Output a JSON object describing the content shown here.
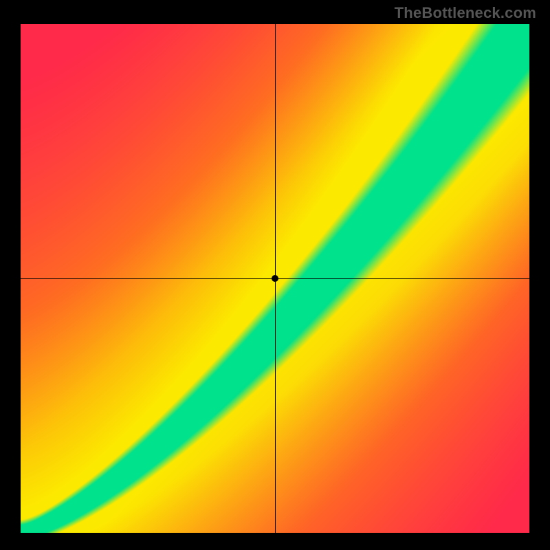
{
  "watermark": "TheBottleneck.com",
  "chart_data": {
    "type": "heatmap",
    "title": "",
    "xlabel": "",
    "ylabel": "",
    "xlim": [
      0,
      1
    ],
    "ylim": [
      0,
      1
    ],
    "center_point": {
      "x": 0.5,
      "y": 0.5
    },
    "description": "Diagonal green balance band surrounded by yellow then orange/red gradient; crosshair axes through center with marker dot.",
    "band": {
      "green_half_width": 0.055,
      "yellow_half_width": 0.15,
      "curve_power": 1.35
    },
    "colors": {
      "green": "#00E28C",
      "yellow": "#FCE900",
      "orange": "#FF7A1A",
      "red": "#FF2A4A"
    }
  },
  "axes": {
    "crosshair_x_fraction": 0.5,
    "crosshair_y_fraction": 0.5
  }
}
